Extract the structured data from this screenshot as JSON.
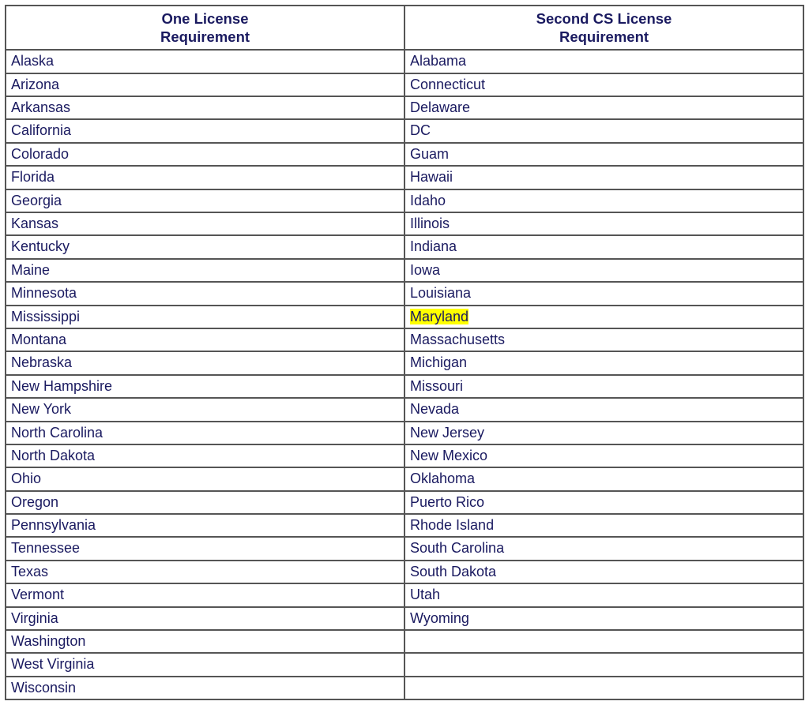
{
  "table": {
    "headers": {
      "col1_line1": "One License",
      "col1_line2": "Requirement",
      "col2_line1": "Second CS License",
      "col2_line2": "Requirement"
    },
    "rows": [
      {
        "c1": "Alaska",
        "c2": "Alabama"
      },
      {
        "c1": "Arizona",
        "c2": "Connecticut"
      },
      {
        "c1": "Arkansas",
        "c2": "Delaware"
      },
      {
        "c1": "California",
        "c2": "DC"
      },
      {
        "c1": "Colorado",
        "c2": "Guam"
      },
      {
        "c1": "Florida",
        "c2": "Hawaii"
      },
      {
        "c1": "Georgia",
        "c2": "Idaho"
      },
      {
        "c1": "Kansas",
        "c2": "Illinois"
      },
      {
        "c1": "Kentucky",
        "c2": "Indiana"
      },
      {
        "c1": "Maine",
        "c2": "Iowa"
      },
      {
        "c1": "Minnesota",
        "c2": "Louisiana"
      },
      {
        "c1": "Mississippi",
        "c2": "Maryland",
        "c2_highlight": true
      },
      {
        "c1": "Montana",
        "c2": "Massachusetts"
      },
      {
        "c1": "Nebraska",
        "c2": "Michigan"
      },
      {
        "c1": "New Hampshire",
        "c2": "Missouri"
      },
      {
        "c1": "New York",
        "c2": "Nevada"
      },
      {
        "c1": "North Carolina",
        "c2": "New Jersey"
      },
      {
        "c1": "North Dakota",
        "c2": "New Mexico"
      },
      {
        "c1": "Ohio",
        "c2": "Oklahoma"
      },
      {
        "c1": "Oregon",
        "c2": "Puerto Rico"
      },
      {
        "c1": "Pennsylvania",
        "c2": "Rhode Island"
      },
      {
        "c1": "Tennessee",
        "c2": "South Carolina"
      },
      {
        "c1": "Texas",
        "c2": "South Dakota"
      },
      {
        "c1": "Vermont",
        "c2": "Utah"
      },
      {
        "c1": "Virginia",
        "c2": "Wyoming"
      },
      {
        "c1": "Washington",
        "c2": ""
      },
      {
        "c1": "West Virginia",
        "c2": ""
      },
      {
        "c1": "Wisconsin",
        "c2": ""
      }
    ]
  }
}
